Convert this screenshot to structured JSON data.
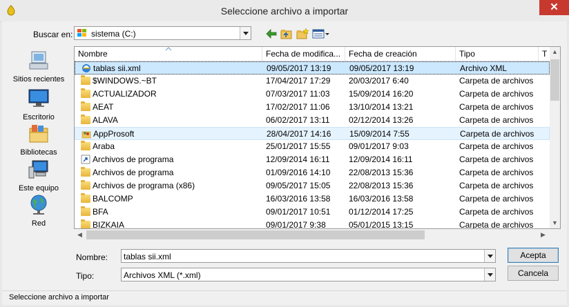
{
  "window": {
    "title": "Seleccione archivo a importar",
    "close_glyph": "✕"
  },
  "toolbar": {
    "lookin_label": "Buscar en:",
    "lookin_value": "sistema (C:)",
    "icons": [
      "back-arrow-icon",
      "up-folder-icon",
      "new-folder-icon",
      "view-menu-icon"
    ]
  },
  "places": [
    {
      "label": "Sitios recientes",
      "icon": "recent-places-icon"
    },
    {
      "label": "Escritorio",
      "icon": "desktop-icon"
    },
    {
      "label": "Bibliotecas",
      "icon": "libraries-icon"
    },
    {
      "label": "Este equipo",
      "icon": "computer-icon"
    },
    {
      "label": "Red",
      "icon": "network-icon"
    }
  ],
  "columns": [
    "Nombre",
    "Fecha de modifica...",
    "Fecha de creación",
    "Tipo",
    "T"
  ],
  "files": [
    {
      "name": "tablas sii.xml",
      "modified": "09/05/2017 13:19",
      "created": "09/05/2017 13:19",
      "type": "Archivo XML",
      "icon": "xml-file-icon",
      "state": "selected"
    },
    {
      "name": "$WINDOWS.~BT",
      "modified": "17/04/2017 17:29",
      "created": "20/03/2017 6:40",
      "type": "Carpeta de archivos",
      "icon": "folder-icon"
    },
    {
      "name": "ACTUALIZADOR",
      "modified": "07/03/2017 11:03",
      "created": "15/09/2014 16:20",
      "type": "Carpeta de archivos",
      "icon": "folder-icon"
    },
    {
      "name": "AEAT",
      "modified": "17/02/2017 11:06",
      "created": "13/10/2014 13:21",
      "type": "Carpeta de archivos",
      "icon": "folder-icon"
    },
    {
      "name": "ALAVA",
      "modified": "06/02/2017 13:11",
      "created": "02/12/2014 13:26",
      "type": "Carpeta de archivos",
      "icon": "folder-icon"
    },
    {
      "name": "AppProsoft",
      "modified": "28/04/2017 14:16",
      "created": "15/09/2014 7:55",
      "type": "Carpeta de archivos",
      "icon": "user-folder-icon",
      "state": "hover"
    },
    {
      "name": "Araba",
      "modified": "25/01/2017 15:55",
      "created": "09/01/2017 9:03",
      "type": "Carpeta de archivos",
      "icon": "folder-icon"
    },
    {
      "name": "Archivos de programa",
      "modified": "12/09/2014 16:11",
      "created": "12/09/2014 16:11",
      "type": "Carpeta de archivos",
      "icon": "shortcut-icon"
    },
    {
      "name": "Archivos de programa",
      "modified": "01/09/2016 14:10",
      "created": "22/08/2013 15:36",
      "type": "Carpeta de archivos",
      "icon": "folder-icon"
    },
    {
      "name": "Archivos de programa (x86)",
      "modified": "09/05/2017 15:05",
      "created": "22/08/2013 15:36",
      "type": "Carpeta de archivos",
      "icon": "folder-icon"
    },
    {
      "name": "BALCOMP",
      "modified": "16/03/2016 13:58",
      "created": "16/03/2016 13:58",
      "type": "Carpeta de archivos",
      "icon": "folder-icon"
    },
    {
      "name": "BFA",
      "modified": "09/01/2017 10:51",
      "created": "01/12/2014 17:25",
      "type": "Carpeta de archivos",
      "icon": "folder-icon"
    },
    {
      "name": "BIZKAIA",
      "modified": "09/01/2017 9:38",
      "created": "05/01/2015 13:15",
      "type": "Carpeta de archivos",
      "icon": "folder-icon"
    }
  ],
  "fields": {
    "filename_label": "Nombre:",
    "filename_value": "tablas sii.xml",
    "type_label": "Tipo:",
    "type_value": "Archivos XML (*.xml)"
  },
  "buttons": {
    "accept": "Acepta",
    "cancel": "Cancela"
  },
  "status": "Seleccione archivo a importar",
  "colors": {
    "selected_row": "#cce8ff",
    "hover_row": "#e5f3ff",
    "close_button": "#c7392f"
  }
}
